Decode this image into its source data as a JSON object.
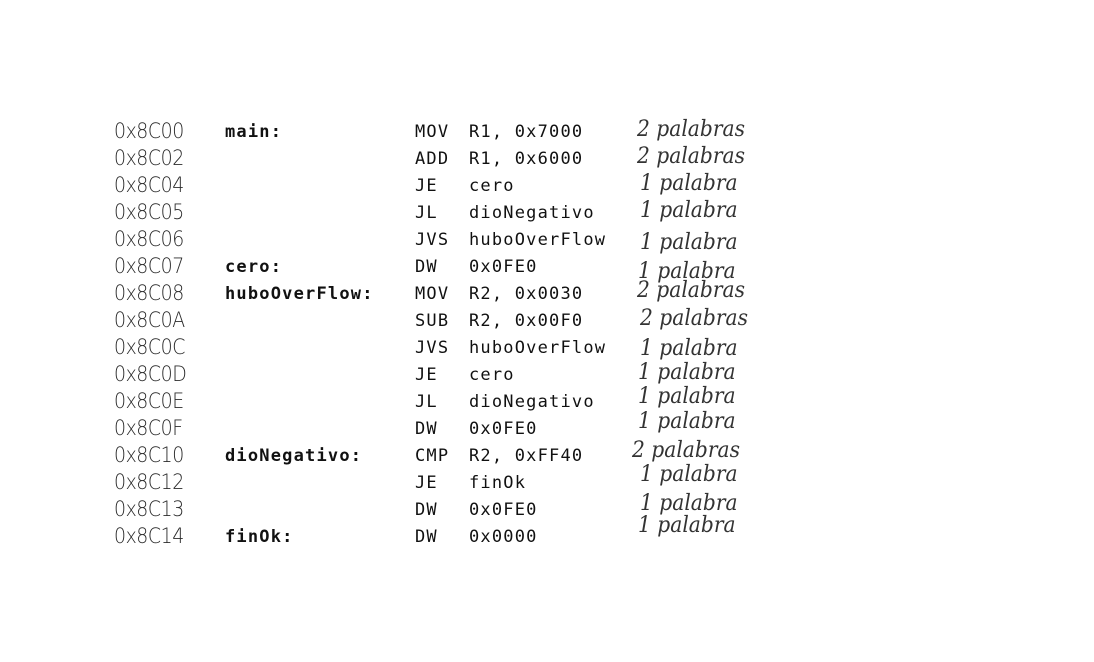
{
  "listing": [
    {
      "address": "0x8C00",
      "label": "main:",
      "mnemonic": "MOV",
      "operands": "R1, 0x7000",
      "note": "2 palabras"
    },
    {
      "address": "0x8C02",
      "label": "",
      "mnemonic": "ADD",
      "operands": "R1, 0x6000",
      "note": "2 palabras"
    },
    {
      "address": "0x8C04",
      "label": "",
      "mnemonic": "JE",
      "operands": "cero",
      "note": "1 palabra"
    },
    {
      "address": "0x8C05",
      "label": "",
      "mnemonic": "JL",
      "operands": "dioNegativo",
      "note": "1 palabra"
    },
    {
      "address": "0x8C06",
      "label": "",
      "mnemonic": "JVS",
      "operands": "huboOverFlow",
      "note": "1 palabra"
    },
    {
      "address": "0x8C07",
      "label": "cero:",
      "mnemonic": "DW",
      "operands": "0x0FE0",
      "note": "1 palabra"
    },
    {
      "address": "0x8C08",
      "label": "huboOverFlow:",
      "mnemonic": "MOV",
      "operands": "R2, 0x0030",
      "note": "2 palabras"
    },
    {
      "address": "0x8C0A",
      "label": "",
      "mnemonic": "SUB",
      "operands": "R2, 0x00F0",
      "note": "2 palabras"
    },
    {
      "address": "0x8C0C",
      "label": "",
      "mnemonic": "JVS",
      "operands": "huboOverFlow",
      "note": "1 palabra"
    },
    {
      "address": "0x8C0D",
      "label": "",
      "mnemonic": "JE",
      "operands": "cero",
      "note": "1 palabra"
    },
    {
      "address": "0x8C0E",
      "label": "",
      "mnemonic": "JL",
      "operands": "dioNegativo",
      "note": "1 palabra"
    },
    {
      "address": "0x8C0F",
      "label": "",
      "mnemonic": "DW",
      "operands": "0x0FE0",
      "note": "1 palabra"
    },
    {
      "address": "0x8C10",
      "label": "dioNegativo:",
      "mnemonic": "CMP",
      "operands": "R2, 0xFF40",
      "note": "2 palabras"
    },
    {
      "address": "0x8C12",
      "label": "",
      "mnemonic": "JE",
      "operands": "finOk",
      "note": "1 palabra"
    },
    {
      "address": "0x8C13",
      "label": "",
      "mnemonic": "DW",
      "operands": "0x0FE0",
      "note": "1 palabra"
    },
    {
      "address": "0x8C14",
      "label": "finOk:",
      "mnemonic": "DW",
      "operands": "0x0000",
      "note": "1 palabra"
    }
  ]
}
